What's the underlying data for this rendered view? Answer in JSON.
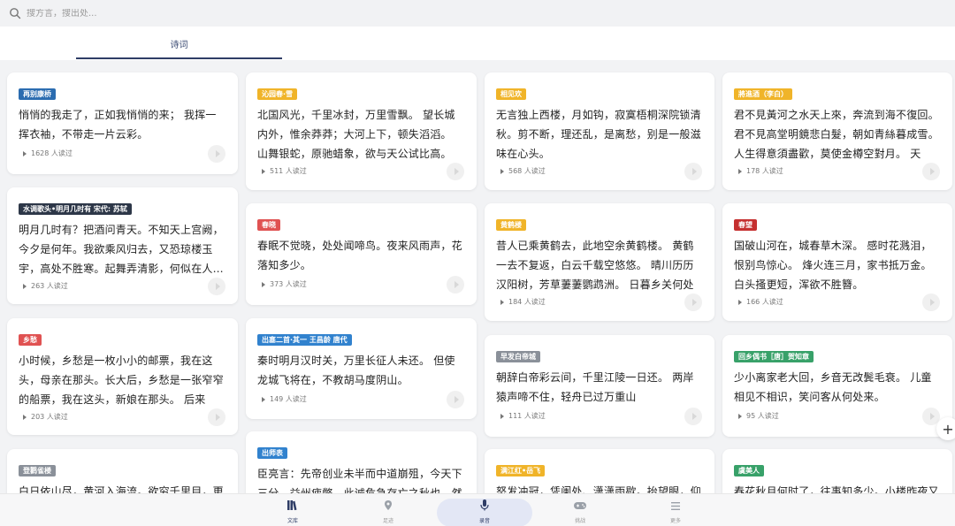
{
  "search": {
    "placeholder": "搜方言，搜出处..."
  },
  "tabs": [
    {
      "label": "诗词"
    }
  ],
  "cards": [
    {
      "tag": "再别康桥",
      "tag_color": "#2b6cb0",
      "text": "悄悄的我走了，正如我悄悄的来； 我挥一挥衣袖，不带走一片云彩。",
      "reads": "1628 人读过"
    },
    {
      "tag": "水调歌头•明月几时有 宋代: 苏轼",
      "tag_color": "#2d3748",
      "text": "明月几时有？把酒问青天。不知天上宫阙，今夕是何年。我欲乘风归去，又恐琼楼玉宇，高处不胜寒。起舞弄清影，何似在人…",
      "reads": "263 人读过"
    },
    {
      "tag": "乡愁",
      "tag_color": "#e05252",
      "text": "小时候，乡愁是一枚小小的邮票，我在这头，母亲在那头。长大后，乡愁是一张窄窄的船票，我在这头，新娘在那头。 后来啊…",
      "reads": "203 人读过"
    },
    {
      "tag": "登鹳雀楼",
      "tag_color": "#8a9099",
      "text": "白日依山尽，黄河入海流。欲穷千里目，更",
      "reads": ""
    },
    {
      "tag": "沁园春·雪",
      "tag_color": "#f0b429",
      "text": "北国风光，千里冰封，万里雪飘。 望长城内外，惟余莽莽；大河上下，顿失滔滔。 山舞银蛇，原驰蜡象，欲与天公试比高。 须晴…",
      "reads": "511 人读过"
    },
    {
      "tag": "春晓",
      "tag_color": "#e05252",
      "text": "春眠不觉晓，处处闻啼鸟。夜来风雨声，花落知多少。",
      "reads": "373 人读过"
    },
    {
      "tag": "出塞二首·其一 王昌龄 唐代",
      "tag_color": "#3182ce",
      "text": "秦时明月汉时关，万里长征人未还。 但使龙城飞将在，不教胡马度阴山。",
      "reads": "149 人读过"
    },
    {
      "tag": "出师表",
      "tag_color": "#3182ce",
      "text": "臣亮言：先帝创业未半而中道崩殂，今天下三分，益州疲弊，此诚危急存亡之秋也。然",
      "reads": ""
    },
    {
      "tag": "相见欢",
      "tag_color": "#f0b429",
      "text": "无言独上西楼，月如钩，寂寞梧桐深院锁清秋。剪不断，理还乱，是离愁，别是一般滋味在心头。",
      "reads": "568 人读过"
    },
    {
      "tag": "黄鹤楼",
      "tag_color": "#f0b429",
      "text": "昔人已乘黄鹤去，此地空余黄鹤楼。 黄鹤一去不复返，白云千载空悠悠。 晴川历历汉阳树，芳草萋萋鹦鹉洲。 日暮乡关何处是？…",
      "reads": "184 人读过"
    },
    {
      "tag": "早发白帝城",
      "tag_color": "#8a9099",
      "text": "朝辞白帝彩云间，千里江陵一日还。 两岸猿声啼不住，轻舟已过万重山",
      "reads": "111 人读过"
    },
    {
      "tag": "满江红•岳飞",
      "tag_color": "#f0b429",
      "text": "怒发冲冠，凭阑处、潇潇雨歇。抬望眼，仰",
      "reads": ""
    },
    {
      "tag": "將進酒（李白）",
      "tag_color": "#f0b429",
      "text": "君不見黃河之水天上來，奔流到海不復回。君不見高堂明鏡悲白髮，朝如青絲暮成雪。人生得意須盡歡，莫使金樽空對月。 天生…",
      "reads": "178 人读过"
    },
    {
      "tag": "春望",
      "tag_color": "#c53030",
      "text": "国破山河在，城春草木深。 感时花溅泪，恨别鸟惊心。 烽火连三月，家书抵万金。 白头搔更短，浑欲不胜簪。",
      "reads": "166 人读过"
    },
    {
      "tag": "回乡偶书［唐］贺知章",
      "tag_color": "#38a169",
      "text": "少小离家老大回，乡音无改鬓毛衰。 儿童相见不相识，笑问客从何处来。",
      "reads": "95 人读过"
    },
    {
      "tag": "虞美人",
      "tag_color": "#38a169",
      "text": "春花秋月何时了，往事知多少。小楼昨夜又",
      "reads": ""
    }
  ],
  "nav": [
    {
      "label": "文库",
      "icon": "library-icon"
    },
    {
      "label": "足迹",
      "icon": "location-icon"
    },
    {
      "label": "录音",
      "icon": "mic-icon"
    },
    {
      "label": "挑战",
      "icon": "gamepad-icon"
    },
    {
      "label": "更多",
      "icon": "menu-icon"
    }
  ]
}
